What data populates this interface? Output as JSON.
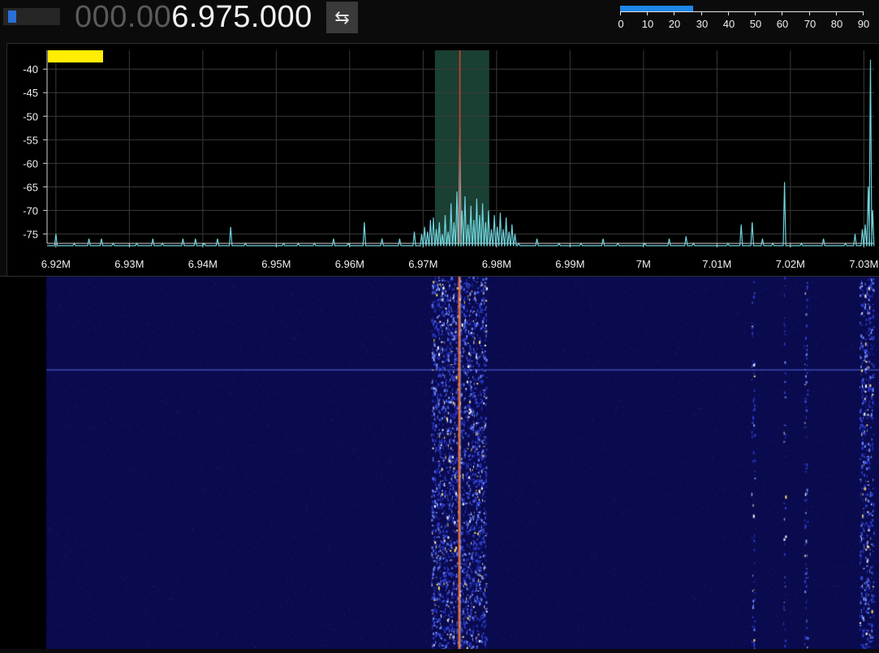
{
  "frequency": {
    "dim_part": "000.00",
    "bright_part": "6.975.000"
  },
  "controls": {
    "swap_icon": "swap-arrows-icon",
    "swap_glyph": "⇆"
  },
  "volume": {
    "level": 0.05
  },
  "meter": {
    "ticks": [
      "0",
      "10",
      "20",
      "30",
      "40",
      "50",
      "60",
      "70",
      "80",
      "90"
    ],
    "level": 27,
    "fill_color": "#1e86e8"
  },
  "spectrum": {
    "y_labels": [
      "-40",
      "-45",
      "-50",
      "-55",
      "-60",
      "-65",
      "-70",
      "-75"
    ],
    "x_labels": [
      "6.92M",
      "6.93M",
      "6.94M",
      "6.95M",
      "6.96M",
      "6.97M",
      "6.98M",
      "6.99M",
      "7M",
      "7.01M",
      "7.02M",
      "7.03M"
    ],
    "tuned_frequency": "6.975M",
    "line_color": "#6fd3dc",
    "marker_color": "#e0402a",
    "passband_color": "#1f4a3c",
    "indicator_color": "#ffee00"
  },
  "chart_data": {
    "type": "line",
    "x_unit": "MHz",
    "xlim": [
      6.9188,
      7.0314
    ],
    "ylim": [
      -77,
      -36
    ],
    "passband": [
      6.9716,
      6.979
    ],
    "marker": 6.975,
    "peaks": [
      {
        "x": 6.92,
        "y": -75
      },
      {
        "x": 6.9225,
        "y": -77
      },
      {
        "x": 6.9245,
        "y": -76
      },
      {
        "x": 6.9262,
        "y": -76
      },
      {
        "x": 6.9278,
        "y": -77
      },
      {
        "x": 6.931,
        "y": -77
      },
      {
        "x": 6.9332,
        "y": -76
      },
      {
        "x": 6.9345,
        "y": -77
      },
      {
        "x": 6.9373,
        "y": -76
      },
      {
        "x": 6.939,
        "y": -76
      },
      {
        "x": 6.9402,
        "y": -77
      },
      {
        "x": 6.942,
        "y": -76
      },
      {
        "x": 6.9438,
        "y": -73.5
      },
      {
        "x": 6.9458,
        "y": -77
      },
      {
        "x": 6.951,
        "y": -77
      },
      {
        "x": 6.953,
        "y": -77
      },
      {
        "x": 6.9552,
        "y": -77
      },
      {
        "x": 6.9578,
        "y": -76
      },
      {
        "x": 6.9598,
        "y": -77
      },
      {
        "x": 6.962,
        "y": -72.5
      },
      {
        "x": 6.9644,
        "y": -76
      },
      {
        "x": 6.9668,
        "y": -76
      },
      {
        "x": 6.9688,
        "y": -74.5
      },
      {
        "x": 6.9698,
        "y": -75
      },
      {
        "x": 6.9702,
        "y": -73.5
      },
      {
        "x": 6.9706,
        "y": -74.5
      },
      {
        "x": 6.971,
        "y": -72
      },
      {
        "x": 6.9714,
        "y": -71.5
      },
      {
        "x": 6.9718,
        "y": -74
      },
      {
        "x": 6.9722,
        "y": -72.5
      },
      {
        "x": 6.9726,
        "y": -75
      },
      {
        "x": 6.973,
        "y": -71
      },
      {
        "x": 6.9734,
        "y": -74.5
      },
      {
        "x": 6.9738,
        "y": -68.5
      },
      {
        "x": 6.9742,
        "y": -72.5
      },
      {
        "x": 6.9746,
        "y": -66
      },
      {
        "x": 6.975,
        "y": -52
      },
      {
        "x": 6.9753,
        "y": -70
      },
      {
        "x": 6.9757,
        "y": -67
      },
      {
        "x": 6.9761,
        "y": -73
      },
      {
        "x": 6.9765,
        "y": -69
      },
      {
        "x": 6.9769,
        "y": -72
      },
      {
        "x": 6.9773,
        "y": -67.5
      },
      {
        "x": 6.9777,
        "y": -71
      },
      {
        "x": 6.9781,
        "y": -68.5
      },
      {
        "x": 6.9785,
        "y": -72.5
      },
      {
        "x": 6.9789,
        "y": -70
      },
      {
        "x": 6.9793,
        "y": -74
      },
      {
        "x": 6.9797,
        "y": -71
      },
      {
        "x": 6.9801,
        "y": -73.5
      },
      {
        "x": 6.9805,
        "y": -70.5
      },
      {
        "x": 6.9809,
        "y": -74
      },
      {
        "x": 6.9813,
        "y": -71.5
      },
      {
        "x": 6.9817,
        "y": -74.5
      },
      {
        "x": 6.9821,
        "y": -73
      },
      {
        "x": 6.9825,
        "y": -75
      },
      {
        "x": 6.983,
        "y": -77
      },
      {
        "x": 6.9855,
        "y": -76
      },
      {
        "x": 6.9885,
        "y": -77
      },
      {
        "x": 6.9915,
        "y": -77
      },
      {
        "x": 6.9945,
        "y": -76
      },
      {
        "x": 6.9965,
        "y": -77
      },
      {
        "x": 7.0002,
        "y": -77
      },
      {
        "x": 7.0035,
        "y": -76
      },
      {
        "x": 7.0058,
        "y": -75.5
      },
      {
        "x": 7.0068,
        "y": -77
      },
      {
        "x": 7.0115,
        "y": -77
      },
      {
        "x": 7.0133,
        "y": -73
      },
      {
        "x": 7.0148,
        "y": -72.5
      },
      {
        "x": 7.0162,
        "y": -76
      },
      {
        "x": 7.0176,
        "y": -77
      },
      {
        "x": 7.0192,
        "y": -64
      },
      {
        "x": 7.0215,
        "y": -77
      },
      {
        "x": 7.0245,
        "y": -76
      },
      {
        "x": 7.0275,
        "y": -77
      },
      {
        "x": 7.0288,
        "y": -75
      },
      {
        "x": 7.0298,
        "y": -74
      },
      {
        "x": 7.0302,
        "y": -73
      },
      {
        "x": 7.0306,
        "y": -65
      },
      {
        "x": 7.0309,
        "y": -38
      },
      {
        "x": 7.0312,
        "y": -70
      }
    ],
    "waterfall": {
      "bands": [
        {
          "from": 6.9712,
          "to": 6.9787,
          "intensity": 1.0
        },
        {
          "from": 7.0148,
          "to": 7.0152,
          "intensity": 0.6
        },
        {
          "from": 7.0191,
          "to": 7.0194,
          "intensity": 0.5
        },
        {
          "from": 7.022,
          "to": 7.0224,
          "intensity": 0.6
        },
        {
          "from": 7.0295,
          "to": 7.0314,
          "intensity": 0.85
        }
      ]
    }
  }
}
